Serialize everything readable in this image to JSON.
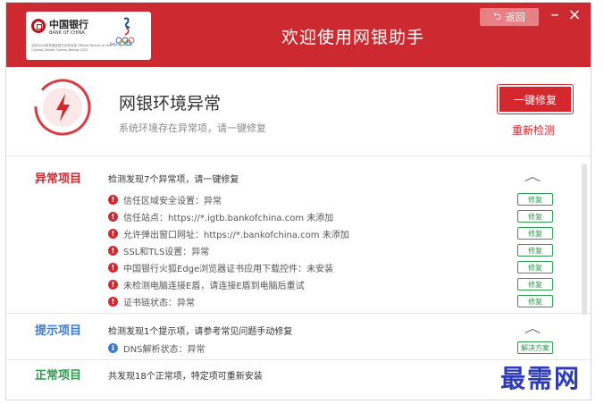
{
  "header": {
    "bank_name_cn": "中国银行",
    "bank_name_en": "BANK OF CHINA",
    "partner_text": "北京2022年冬奥会官方合作伙伴 Official Partner of the Olympic Winter Games Beijing 2022",
    "olympic_text": "Beijing 2022",
    "title": "欢迎使用网银助手",
    "back_label": "返回",
    "back_icon": "return-arrow-icon",
    "minimize_symbol": "–",
    "close_symbol": "×"
  },
  "status": {
    "title": "网银环境异常",
    "subtitle": "系统环境存在异常项，请一键修复",
    "fix_button": "一键修复",
    "recheck_link": "重新检测",
    "icon": "lightning-warning-icon",
    "accent_color": "#d4272e"
  },
  "sections": {
    "abnormal": {
      "label": "异常项目",
      "summary": "检测发现7个异常项，请一键修复",
      "items": [
        {
          "text": "信任区域安全设置：异常",
          "action": "修复"
        },
        {
          "text": "信任站点：https://*.igtb.bankofchina.com 未添加",
          "action": "修复"
        },
        {
          "text": "允许弹出窗口网址：https://*.bankofchina.com 未添加",
          "action": "修复"
        },
        {
          "text": "SSL和TLS设置：异常",
          "action": "修复"
        },
        {
          "text": "中国银行火狐Edge浏览器证书应用下载控件：未安装",
          "action": "修复"
        },
        {
          "text": "未检测电脑连接E盾，请连接E盾到电脑后重试",
          "action": "修复"
        },
        {
          "text": "证书链状态：异常",
          "action": "修复"
        }
      ]
    },
    "hint": {
      "label": "提示项目",
      "summary": "检测发现1个提示项，请参考常见问题手动修复",
      "items": [
        {
          "text": "DNS解析状态：异常",
          "action": "解决方案"
        }
      ]
    },
    "normal": {
      "label": "正常项目",
      "summary": "共发现18个正常项，特定项可重新安装"
    }
  },
  "watermark": "最需网"
}
